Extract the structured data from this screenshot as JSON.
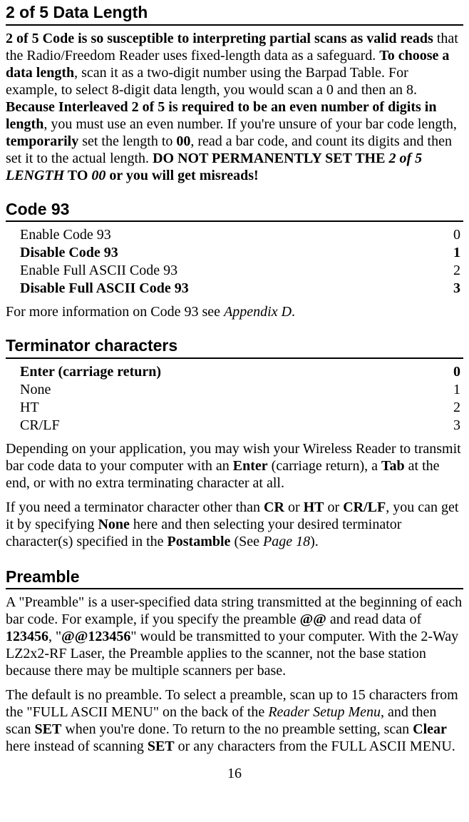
{
  "sections": {
    "datalen": {
      "title": "2 of 5 Data Length"
    },
    "code93": {
      "title": "Code 93",
      "options": [
        {
          "label": "Enable Code 93",
          "value": "0",
          "bold": false
        },
        {
          "label": "Disable Code 93",
          "value": "1",
          "bold": true
        },
        {
          "label": "Enable Full ASCII Code 93",
          "value": "2",
          "bold": false
        },
        {
          "label": "Disable Full ASCII Code 93",
          "value": "3",
          "bold": true
        }
      ]
    },
    "terminator": {
      "title": "Terminator characters",
      "options": [
        {
          "label": "Enter (carriage return)",
          "value": "0",
          "bold": true
        },
        {
          "label": "None",
          "value": "1",
          "bold": false
        },
        {
          "label": "HT",
          "value": "2",
          "bold": false
        },
        {
          "label": "CR/LF",
          "value": "3",
          "bold": false
        }
      ]
    },
    "preamble": {
      "title": "Preamble"
    }
  },
  "text": {
    "p1_a": "2 of 5 Code is so susceptible to interpreting partial scans as valid reads",
    "p1_b": " that the Radio/Freedom Reader uses fixed-length data as a safeguard. ",
    "p1_c": "To choose a data length",
    "p1_d": ", scan it as a two-digit number using the Barpad Table. For example, to select 8-digit data length, you would scan a 0 and then an 8. ",
    "p1_e": "Because Interleaved 2 of 5 is required to be an even number of digits in length",
    "p1_f": ", you must use an even number. If you're unsure of your bar code length, ",
    "p1_g": "temporarily",
    "p1_h": " set the length to ",
    "p1_i": "00",
    "p1_j": ", read a bar code, and count its digits and then set it to the actual length.  ",
    "p1_k": "DO NOT PERMANENTLY SET THE ",
    "p1_l": "2 of 5 LENGTH",
    "p1_m": " TO ",
    "p1_n": "00",
    "p1_o": " or you will get misreads!",
    "p2_a": "For more information on Code 93 see ",
    "p2_b": "Appendix D",
    "p2_c": ".",
    "p3_a": "Depending on your application, you may wish your Wireless Reader to transmit bar code data to your computer with an ",
    "p3_b": "Enter",
    "p3_c": " (carriage return), a ",
    "p3_d": "Tab",
    "p3_e": " at the end, or with no extra terminating character at all.",
    "p4_a": "If you need a terminator character other than ",
    "p4_b": "CR",
    "p4_c": " or ",
    "p4_d": "HT",
    "p4_e": " or ",
    "p4_f": "CR/LF",
    "p4_g": ", you can get it by specifying ",
    "p4_h": "None",
    "p4_i": " here and then selecting your desired terminator character(s) specified in the ",
    "p4_j": "Postamble",
    "p4_k": " (See ",
    "p4_l": "Page 18",
    "p4_m": ").",
    "p5_a": "A \"Preamble\" is a user-specified data string transmitted at the beginning of each bar code.  For example, if you specify the preamble ",
    "p5_b": "@@",
    "p5_c": " and read data of ",
    "p5_d": "123456",
    "p5_e": ", \"",
    "p5_f": "@@123456",
    "p5_g": "\" would be transmitted to your computer.  With the 2-Way LZ2x2-RF Laser, the Preamble applies to the scanner, not the base station because there may be multiple scanners per base.",
    "p6_a": "The default is no preamble.  To select a preamble, scan up to 15 characters from the \"FULL ASCII MENU\" on the back of the ",
    "p6_b": "Reader Setup Menu",
    "p6_c": ", and then scan ",
    "p6_d": "SET",
    "p6_e": " when you're done.  To return to the no preamble setting, scan ",
    "p6_f": "Clear",
    "p6_g": " here instead of scanning ",
    "p6_h": "SET",
    "p6_i": " or any characters from the FULL ASCII MENU."
  },
  "page_number": "16"
}
